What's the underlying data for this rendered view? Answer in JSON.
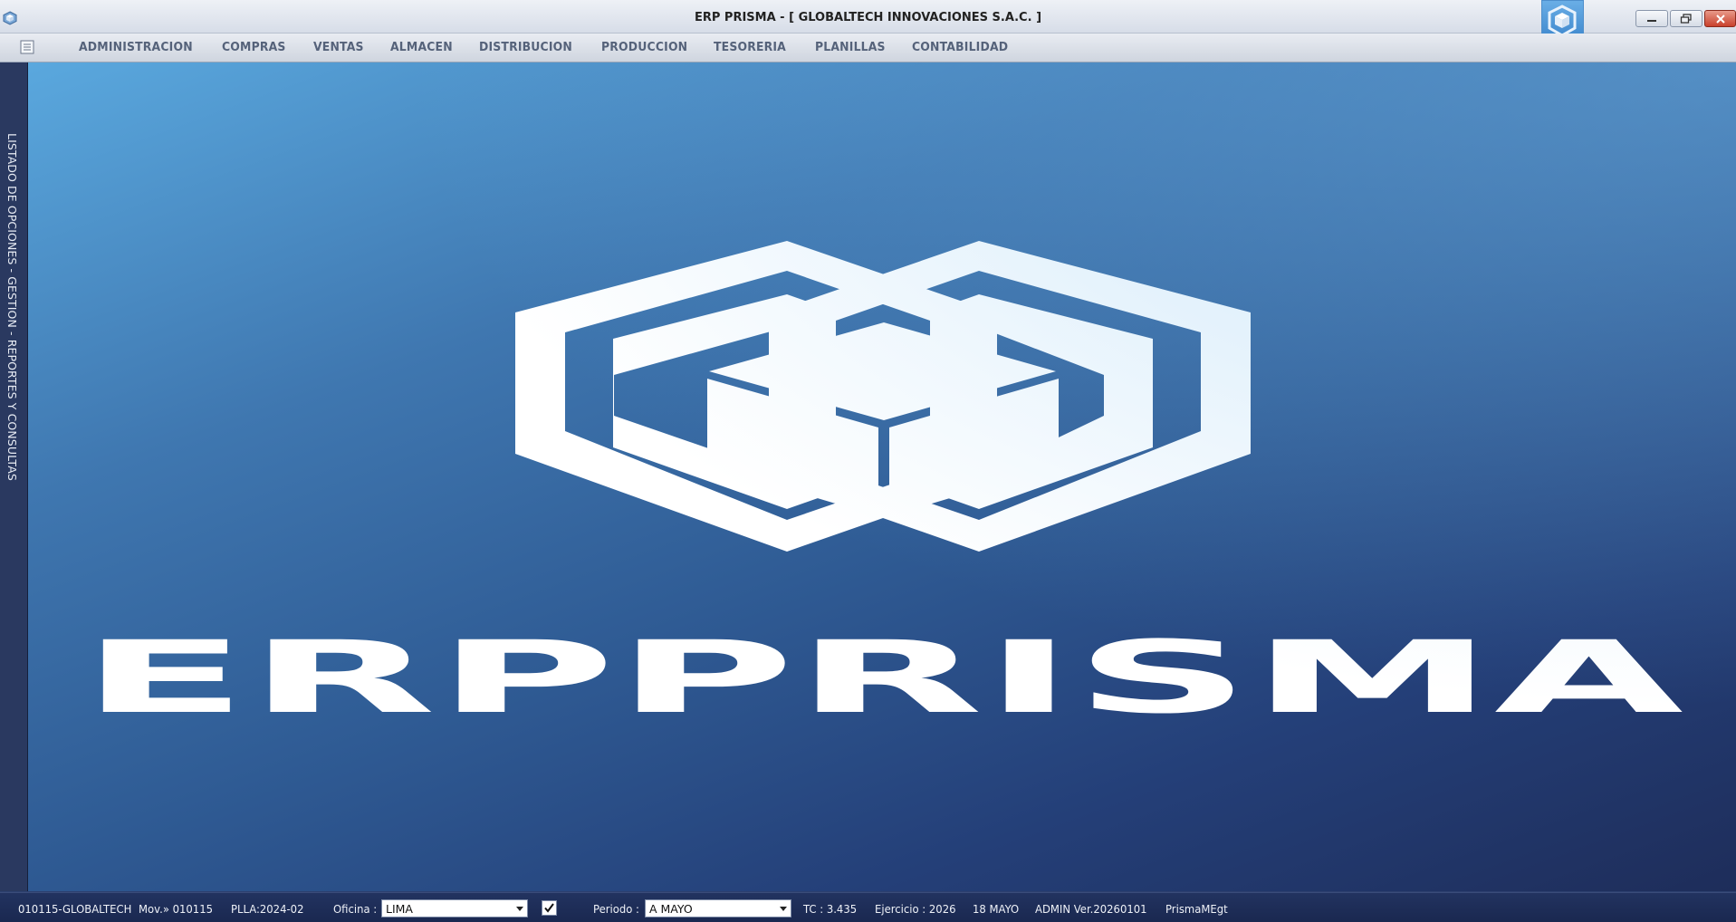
{
  "window": {
    "title": "ERP PRISMA - [ GLOBALTECH INNOVACIONES S.A.C. ]"
  },
  "menu": {
    "items": [
      {
        "label": "ADMINISTRACION"
      },
      {
        "label": "COMPRAS"
      },
      {
        "label": "VENTAS"
      },
      {
        "label": "ALMACEN"
      },
      {
        "label": "DISTRIBUCION"
      },
      {
        "label": "PRODUCCION"
      },
      {
        "label": "TESORERIA"
      },
      {
        "label": "PLANILLAS"
      },
      {
        "label": "CONTABILIDAD"
      }
    ]
  },
  "side_panel": {
    "label": "LISTADO DE OPCIONES - GESTION - REPORTES Y CONSULTAS"
  },
  "logo": {
    "wordmark": "ERPPRISMA"
  },
  "status": {
    "company": "010115-GLOBALTECH",
    "movement": "Mov.» 010115",
    "plla": "PLLA:2024-02",
    "office_label": "Oficina :",
    "office_value": "LIMA",
    "office_checked": true,
    "period_label": "Periodo :",
    "period_value": "A MAYO",
    "tc": "TC : 3.435",
    "exercise": "Ejercicio : 2026",
    "date": "18 MAYO",
    "user_version": "ADMIN Ver.20260101",
    "extra": "PrismaMEgt"
  },
  "colors": {
    "canvas_top": "#5aa8de",
    "canvas_bottom": "#1e2d5a",
    "statusbar": "#1f2e58",
    "logo": "#ffffff"
  },
  "icons": {
    "app": "prisma-cube-icon",
    "menu_toggle": "list-icon",
    "minimize": "minimize-icon",
    "restore": "restore-icon",
    "close": "close-icon",
    "dropdown": "chevron-down-icon",
    "check": "checkmark-icon"
  }
}
